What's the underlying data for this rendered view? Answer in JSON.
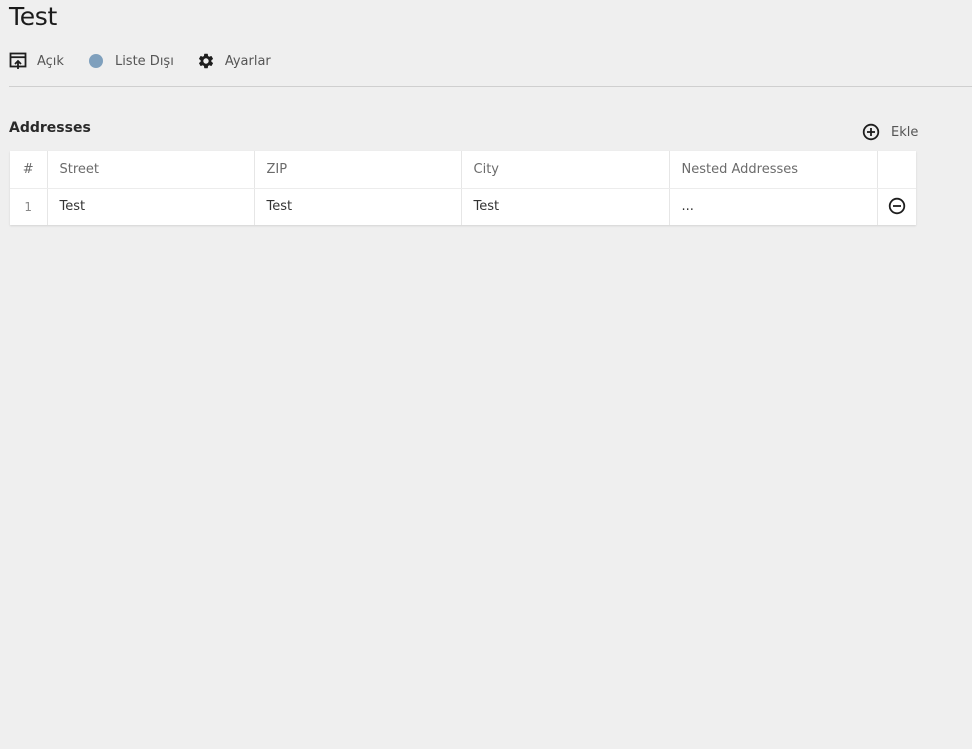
{
  "page": {
    "title": "Test"
  },
  "toolbar": {
    "open_label": "Açık",
    "list_out_label": "Liste Dışı",
    "settings_label": "Ayarlar",
    "status_color": "#7fa0bd"
  },
  "addresses": {
    "title": "Addresses",
    "add_label": "Ekle",
    "columns": {
      "index": "#",
      "street": "Street",
      "zip": "ZIP",
      "city": "City",
      "nested": "Nested Addresses"
    },
    "rows": [
      {
        "index": "1",
        "street": "Test",
        "zip": "Test",
        "city": "Test",
        "nested": "..."
      }
    ]
  },
  "icons": {
    "open": "open-in-window-icon",
    "status": "status-dot-icon",
    "settings": "gear-icon",
    "add": "plus-circle-icon",
    "remove": "minus-circle-icon"
  }
}
